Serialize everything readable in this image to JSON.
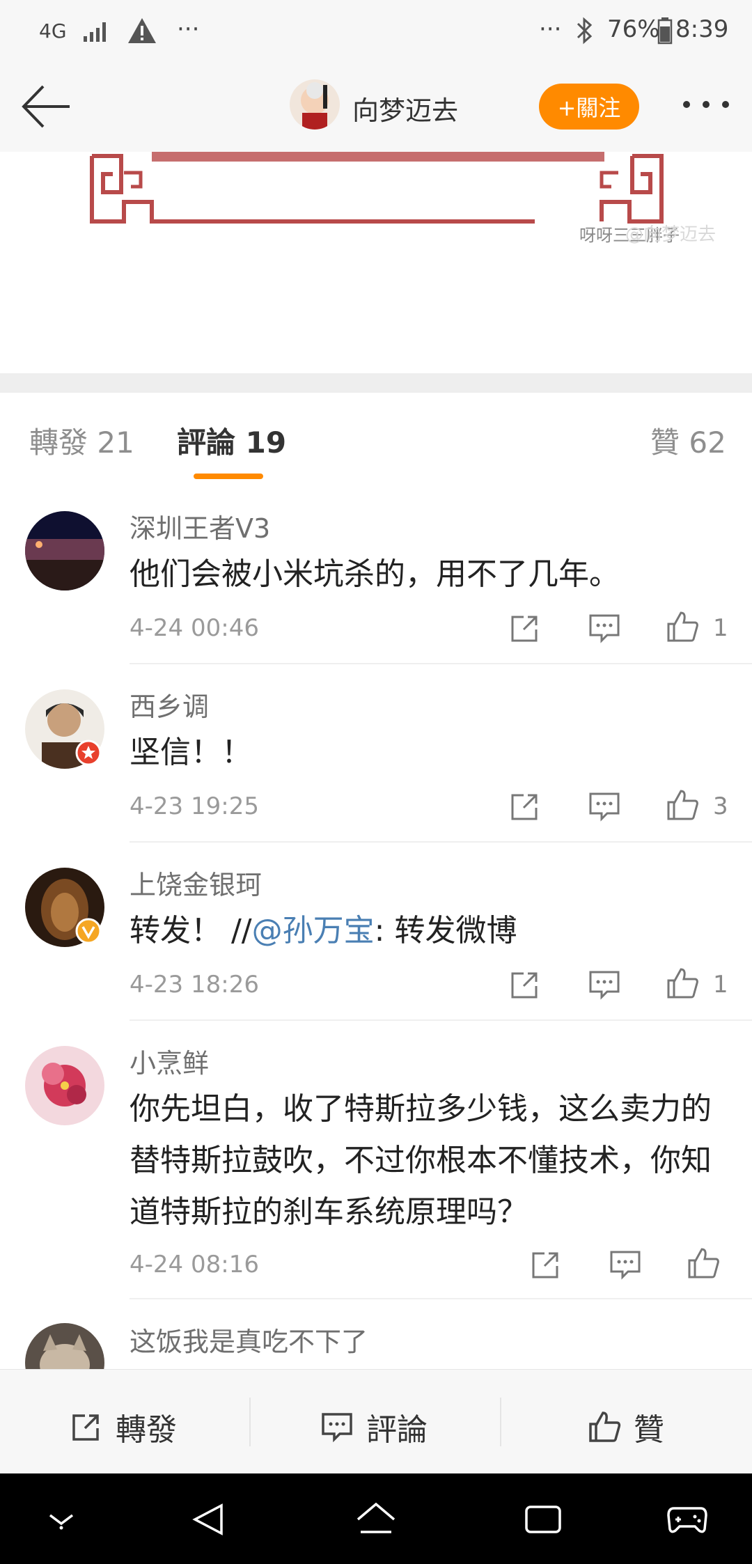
{
  "status_bar": {
    "network": "4G",
    "left_extra": "···",
    "right_extra": "···",
    "battery": "76%",
    "time": "8:39"
  },
  "header": {
    "username": "向梦迈去",
    "follow_label": "+關注"
  },
  "post_image": {
    "watermark_1": "呀呀三三胖子",
    "watermark_2": "@向梦迈去"
  },
  "tabs": [
    {
      "label": "轉發 21"
    },
    {
      "label": "評論 19"
    },
    {
      "label": "贊 62"
    }
  ],
  "comments": [
    {
      "name": "深圳王者V3",
      "text": "他们会被小米坑杀的，用不了几年。",
      "time": "4-24 00:46",
      "likes": "1"
    },
    {
      "name": "西乡调",
      "text": "坚信！！",
      "time": "4-23 19:25",
      "likes": "3"
    },
    {
      "name": "上饶金银珂",
      "text_prefix": "转发！ //",
      "text_mention": "@孙万宝",
      "text_suffix": ": 转发微博",
      "time": "4-23 18:26",
      "likes": "1"
    },
    {
      "name": "小烹鲜",
      "text": "你先坦白，收了特斯拉多少钱，这么卖力的替特斯拉鼓吹，不过你根本不懂技术，你知道特斯拉的刹车系统原理吗？",
      "time": "4-24 08:16",
      "likes": ""
    },
    {
      "name": "这饭我是真吃不下了"
    }
  ],
  "action_bar": {
    "repost": "轉發",
    "comment": "評論",
    "like": "贊"
  },
  "colors": {
    "accent": "#ff8a00",
    "link": "#4a7fb3"
  }
}
